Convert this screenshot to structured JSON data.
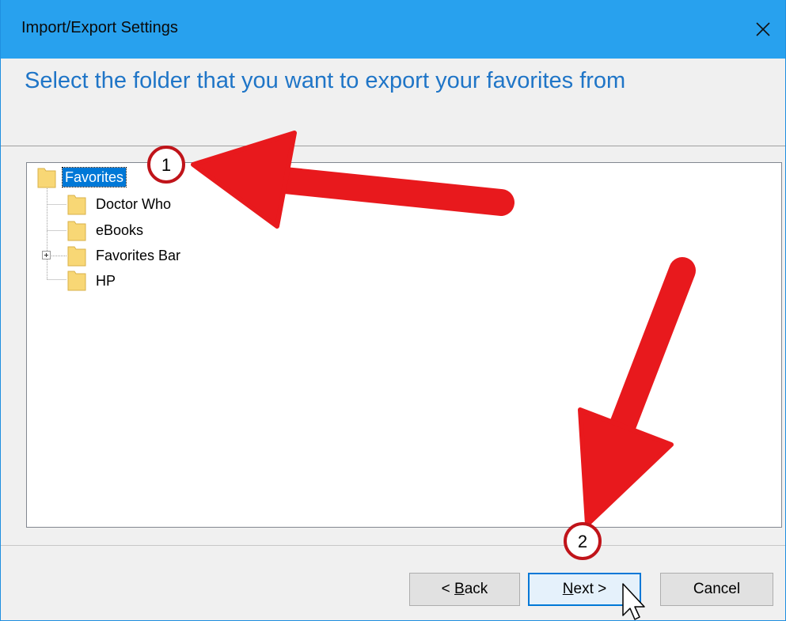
{
  "window": {
    "title": "Import/Export Settings"
  },
  "heading": "Select the folder that you want to export your favorites from",
  "tree": {
    "root": {
      "label": "Favorites",
      "selected": true,
      "icon": "folder-icon"
    },
    "children": [
      {
        "label": "Doctor Who",
        "icon": "folder-icon",
        "expandable": false
      },
      {
        "label": "eBooks",
        "icon": "folder-icon",
        "expandable": false
      },
      {
        "label": "Favorites Bar",
        "icon": "folder-icon",
        "expandable": true,
        "expander": "+"
      },
      {
        "label": "HP",
        "icon": "folder-icon",
        "expandable": false
      }
    ]
  },
  "buttons": {
    "back": {
      "label_underlined": "B",
      "label_rest": "ack",
      "prefix": "< "
    },
    "next": {
      "label_underlined": "N",
      "label_rest": "ext >"
    },
    "cancel": {
      "label": "Cancel"
    }
  },
  "annotations": [
    {
      "number": "1",
      "points_to": "Favorites"
    },
    {
      "number": "2",
      "points_to": "Next >"
    }
  ],
  "colors": {
    "titlebar": "#28a1ee",
    "heading": "#1f75c7",
    "selection": "#0078d7",
    "annotation_arrow": "#e8191d",
    "folder": "#f8d775"
  }
}
